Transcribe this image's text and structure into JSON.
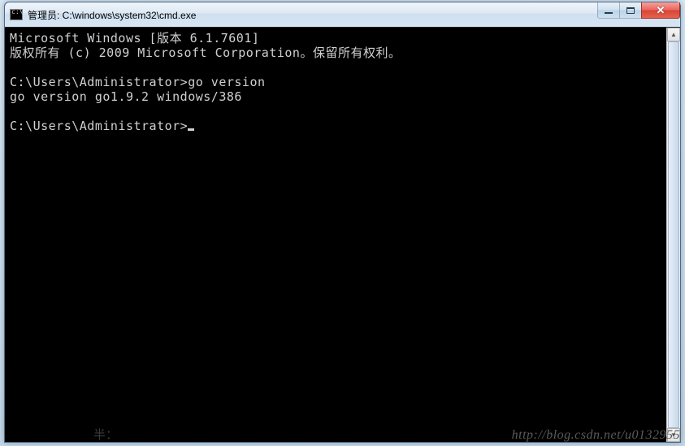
{
  "window": {
    "title": "管理员: C:\\windows\\system32\\cmd.exe"
  },
  "terminal": {
    "lines": [
      "Microsoft Windows [版本 6.1.7601]",
      "版权所有 (c) 2009 Microsoft Corporation。保留所有权利。",
      "",
      "C:\\Users\\Administrator>go version",
      "go version go1.9.2 windows/386",
      "",
      "C:\\Users\\Administrator>"
    ]
  },
  "watermark": "http://blog.csdn.net/u0132955",
  "footer": "半："
}
